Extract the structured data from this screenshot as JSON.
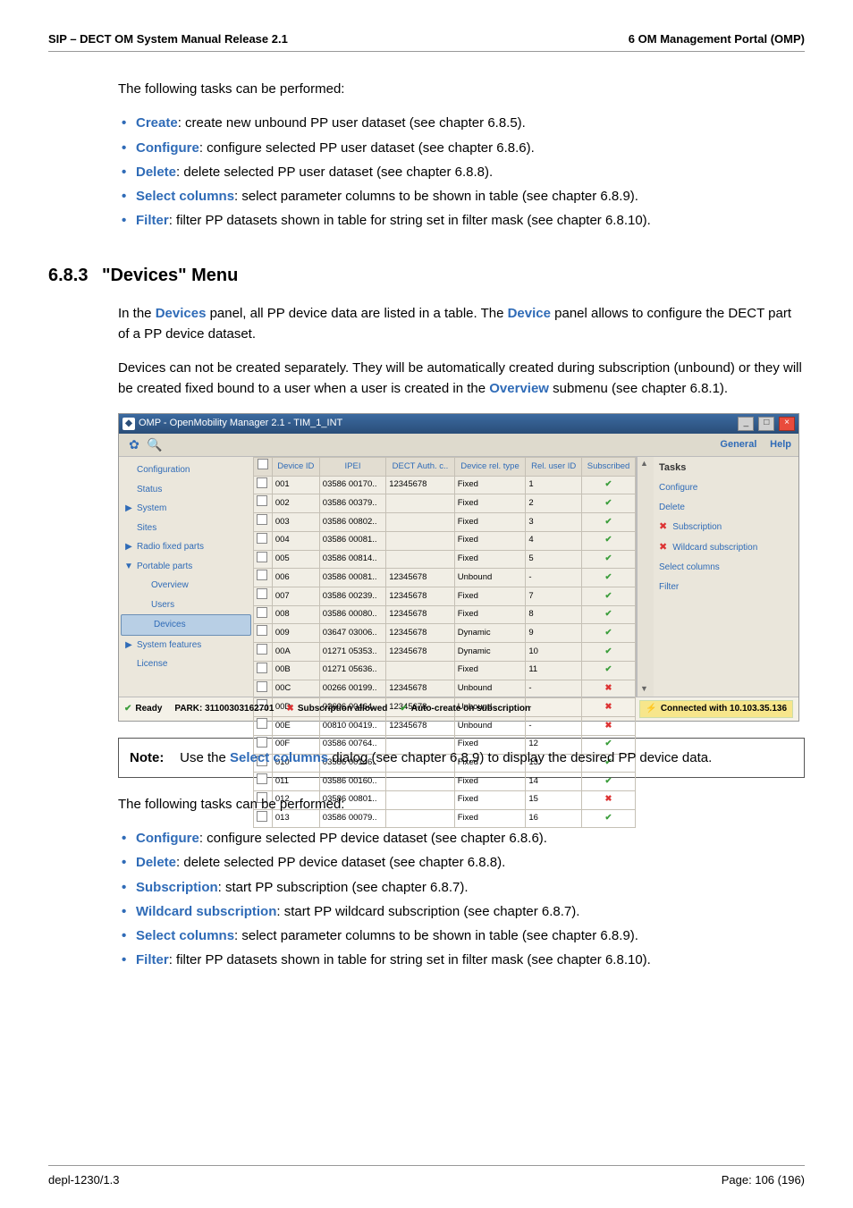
{
  "header": {
    "left": "SIP – DECT OM System Manual Release 2.1",
    "right": "6 OM Management Portal (OMP)"
  },
  "intro_line": "The following tasks can be performed:",
  "top_bullets": [
    {
      "term": "Create",
      "desc": ": create new unbound PP user dataset (see chapter 6.8.5)."
    },
    {
      "term": "Configure",
      "desc": ": configure selected PP user dataset (see chapter 6.8.6)."
    },
    {
      "term": "Delete",
      "desc": ": delete selected PP user dataset (see chapter 6.8.8)."
    },
    {
      "term": "Select columns",
      "desc": ": select parameter columns to be shown in table (see chapter 6.8.9)."
    },
    {
      "term": "Filter",
      "desc": ": filter PP datasets shown in table for string set in filter mask (see chapter 6.8.10)."
    }
  ],
  "section": {
    "number": "6.8.3",
    "title": "\"Devices\" Menu"
  },
  "para1_pre": "In the ",
  "para1_term1": "Devices",
  "para1_mid": " panel, all PP device data are listed in a table. The ",
  "para1_term2": "Device",
  "para1_post": " panel allows to configure the DECT part of a PP device dataset.",
  "para2_pre": "Devices can not be created separately. They will be automatically created during subscription (unbound) or they will be created fixed bound to a user when a user is created in the ",
  "para2_term": "Overview",
  "para2_post": " submenu (see chapter 6.8.1).",
  "note": {
    "label": "Note:",
    "pre": "Use the ",
    "term": "Select columns",
    "post": " dialog (see chapter 6.8.9) to display the desired PP device data."
  },
  "tasks_line": "The following tasks can be performed:",
  "task_bullets": [
    {
      "term": "Configure",
      "desc": ": configure selected PP device dataset (see chapter 6.8.6)."
    },
    {
      "term": "Delete",
      "desc": ": delete selected PP device dataset (see chapter 6.8.8)."
    },
    {
      "term": "Subscription",
      "desc": ": start PP subscription (see chapter 6.8.7)."
    },
    {
      "term": "Wildcard subscription",
      "desc": ": start PP wildcard subscription (see chapter 6.8.7)."
    },
    {
      "term": "Select columns",
      "desc": ": select parameter columns to be shown in table (see chapter 6.8.9)."
    },
    {
      "term": "Filter",
      "desc": ": filter PP datasets shown in table for string set in filter mask (see chapter 6.8.10)."
    }
  ],
  "footer": {
    "left": "depl-1230/1.3",
    "right": "Page: 106 (196)"
  },
  "shot": {
    "title": "OMP - OpenMobility Manager 2.1 - TIM_1_INT",
    "toolbar": {
      "general": "General",
      "help": "Help"
    },
    "nav": {
      "configuration": "Configuration",
      "status": "Status",
      "system": "System",
      "sites": "Sites",
      "radio_fixed": "Radio fixed parts",
      "portable_parts": "Portable parts",
      "overview": "Overview",
      "users": "Users",
      "devices": "Devices",
      "system_features": "System features",
      "license": "License"
    },
    "columns": [
      "",
      "Device ID",
      "IPEI",
      "DECT Auth. c..",
      "Device rel. type",
      "Rel. user ID",
      "Subscribed"
    ],
    "rows": [
      {
        "id": "001",
        "ipei": "03586 00170..",
        "dect": "12345678",
        "type": "Fixed",
        "rel": "1",
        "sub": "ok"
      },
      {
        "id": "002",
        "ipei": "03586 00379..",
        "dect": "",
        "type": "Fixed",
        "rel": "2",
        "sub": "ok"
      },
      {
        "id": "003",
        "ipei": "03586 00802..",
        "dect": "",
        "type": "Fixed",
        "rel": "3",
        "sub": "ok"
      },
      {
        "id": "004",
        "ipei": "03586 00081..",
        "dect": "",
        "type": "Fixed",
        "rel": "4",
        "sub": "ok"
      },
      {
        "id": "005",
        "ipei": "03586 00814..",
        "dect": "",
        "type": "Fixed",
        "rel": "5",
        "sub": "ok"
      },
      {
        "id": "006",
        "ipei": "03586 00081..",
        "dect": "12345678",
        "type": "Unbound",
        "rel": "-",
        "sub": "ok"
      },
      {
        "id": "007",
        "ipei": "03586 00239..",
        "dect": "12345678",
        "type": "Fixed",
        "rel": "7",
        "sub": "ok"
      },
      {
        "id": "008",
        "ipei": "03586 00080..",
        "dect": "12345678",
        "type": "Fixed",
        "rel": "8",
        "sub": "ok"
      },
      {
        "id": "009",
        "ipei": "03647 03006..",
        "dect": "12345678",
        "type": "Dynamic",
        "rel": "9",
        "sub": "ok"
      },
      {
        "id": "00A",
        "ipei": "01271 05353..",
        "dect": "12345678",
        "type": "Dynamic",
        "rel": "10",
        "sub": "ok"
      },
      {
        "id": "00B",
        "ipei": "01271 05636..",
        "dect": "",
        "type": "Fixed",
        "rel": "11",
        "sub": "ok"
      },
      {
        "id": "00C",
        "ipei": "00266 00199..",
        "dect": "12345678",
        "type": "Unbound",
        "rel": "-",
        "sub": "x"
      },
      {
        "id": "00D",
        "ipei": "02606 00464..",
        "dect": "12345678",
        "type": "Unbound",
        "rel": "-",
        "sub": "x"
      },
      {
        "id": "00E",
        "ipei": "00810 00419..",
        "dect": "12345678",
        "type": "Unbound",
        "rel": "-",
        "sub": "x"
      },
      {
        "id": "00F",
        "ipei": "03586 00764..",
        "dect": "",
        "type": "Fixed",
        "rel": "12",
        "sub": "ok"
      },
      {
        "id": "010",
        "ipei": "03586 00146..",
        "dect": "",
        "type": "Fixed",
        "rel": "13",
        "sub": "ok"
      },
      {
        "id": "011",
        "ipei": "03586 00160..",
        "dect": "",
        "type": "Fixed",
        "rel": "14",
        "sub": "ok"
      },
      {
        "id": "012",
        "ipei": "03586 00801..",
        "dect": "",
        "type": "Fixed",
        "rel": "15",
        "sub": "x"
      },
      {
        "id": "013",
        "ipei": "03586 00079..",
        "dect": "",
        "type": "Fixed",
        "rel": "16",
        "sub": "ok"
      }
    ],
    "tasks": {
      "title": "Tasks",
      "configure": "Configure",
      "delete": "Delete",
      "subscription": "Subscription",
      "wildcard": "Wildcard subscription",
      "select_cols": "Select columns",
      "filter": "Filter"
    },
    "status": {
      "ready": "Ready",
      "park": "PARK: 31100303162701",
      "sub_allowed": "Subscription allowed",
      "auto_create": "Auto-create on subscription",
      "connected": "Connected with 10.103.35.136"
    }
  }
}
